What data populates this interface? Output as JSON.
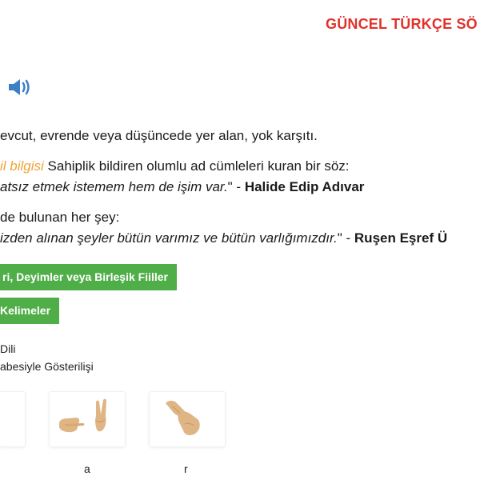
{
  "site": {
    "title": "GÜNCEL TÜRKÇE SÖ"
  },
  "icons": {
    "speaker": "speaker-volume-icon",
    "accent": "#e0322b",
    "button_green": "#4fae48",
    "highlight": "#f0a23b"
  },
  "definitions": [
    {
      "text": "evcut, evrende veya düşüncede yer alan, yok karşıtı."
    },
    {
      "grammar_label": "il bilgisi",
      "text": " Sahiplik bildiren olumlu ad cümleleri kuran bir söz:"
    },
    {
      "quote": "atsız etmek istemem hem de işim var.",
      "quote_end": "\" - ",
      "author": "Halide Edip Adıvar"
    },
    {
      "text": "de bulunan her şey:"
    },
    {
      "quote": "izden alınan şeyler bütün varımız ve bütün varlığımızdır.",
      "quote_end": "\" - ",
      "author": "Ruşen Eşref Ü"
    }
  ],
  "buttons": {
    "compounds": "ri, Deyimler veya Birleşik Fiiller",
    "related": "Kelimeler"
  },
  "sign_language": {
    "title": "Dili",
    "subtitle": "abesiyle Gösterilişi",
    "letters": [
      "a",
      "r"
    ]
  }
}
